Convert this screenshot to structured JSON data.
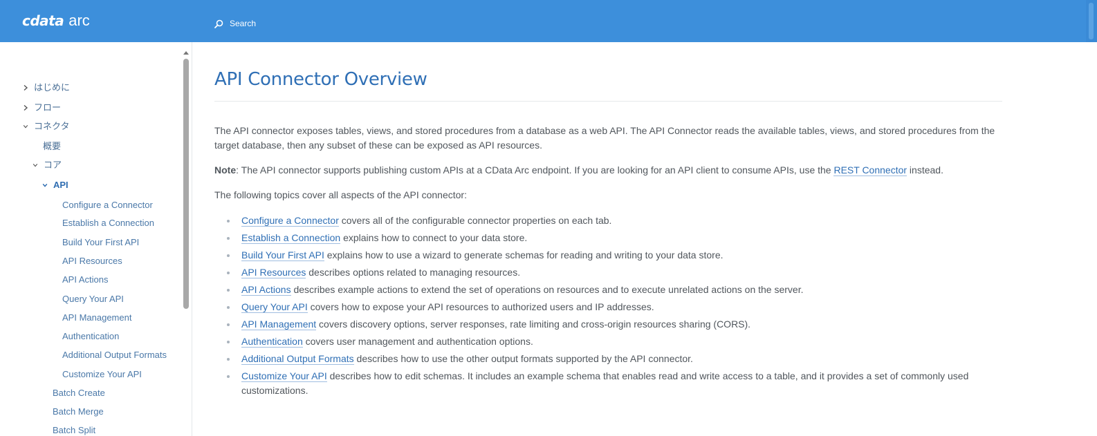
{
  "header": {
    "brand": "cdata",
    "product": "arc",
    "search_label": "Search",
    "search_icon": "search-icon",
    "color": "#3d8fdb"
  },
  "sidebar": {
    "items": [
      {
        "label": "はじめに",
        "state": "collapsed"
      },
      {
        "label": "フロー",
        "state": "collapsed"
      },
      {
        "label": "コネクタ",
        "state": "expanded"
      },
      {
        "label": "概要",
        "state": "leaf"
      },
      {
        "label": "コア",
        "state": "expanded"
      },
      {
        "label": "API",
        "state": "expanded-active"
      },
      {
        "label": "Configure a Connector",
        "state": "leaf"
      },
      {
        "label": "Establish a Connection",
        "state": "leaf"
      },
      {
        "label": "Build Your First API",
        "state": "leaf"
      },
      {
        "label": "API Resources",
        "state": "leaf"
      },
      {
        "label": "API Actions",
        "state": "leaf"
      },
      {
        "label": "Query Your API",
        "state": "leaf"
      },
      {
        "label": "API Management",
        "state": "leaf"
      },
      {
        "label": "Authentication",
        "state": "leaf"
      },
      {
        "label": "Additional Output Formats",
        "state": "leaf"
      },
      {
        "label": "Customize Your API",
        "state": "leaf"
      },
      {
        "label": "Batch Create",
        "state": "leaf"
      },
      {
        "label": "Batch Merge",
        "state": "leaf"
      },
      {
        "label": "Batch Split",
        "state": "leaf"
      }
    ]
  },
  "main": {
    "title": "API Connector Overview",
    "intro": "The API connector exposes tables, views, and stored procedures from a database as a web API. The API Connector reads the available tables, views, and stored procedures from the target database, then any subset of these can be exposed as API resources.",
    "note_label": "Note",
    "note_text_before": ": The API connector supports publishing custom APIs at a CData Arc endpoint. If you are looking for an API client to consume APIs, use the ",
    "note_link": "REST Connector",
    "note_text_after": " instead.",
    "topics_intro": "The following topics cover all aspects of the API connector:",
    "topics": [
      {
        "link": "Configure a Connector",
        "text": " covers all of the configurable connector properties on each tab."
      },
      {
        "link": "Establish a Connection",
        "text": " explains how to connect to your data store."
      },
      {
        "link": "Build Your First API",
        "text": " explains how to use a wizard to generate schemas for reading and writing to your data store."
      },
      {
        "link": "API Resources",
        "text": " describes options related to managing resources."
      },
      {
        "link": "API Actions",
        "text": " describes example actions to extend the set of operations on resources and to execute unrelated actions on the server."
      },
      {
        "link": "Query Your API",
        "text": " covers how to expose your API resources to authorized users and IP addresses."
      },
      {
        "link": "API Management",
        "text": " covers discovery options, server responses, rate limiting and cross-origin resources sharing (CORS)."
      },
      {
        "link": "Authentication",
        "text": " covers user management and authentication options."
      },
      {
        "link": "Additional Output Formats",
        "text": " describes how to use the other output formats supported by the API connector."
      },
      {
        "link": "Customize Your API",
        "text": " describes how to edit schemas. It includes an example schema that enables read and write access to a table, and it provides a set of commonly used customizations."
      }
    ]
  }
}
